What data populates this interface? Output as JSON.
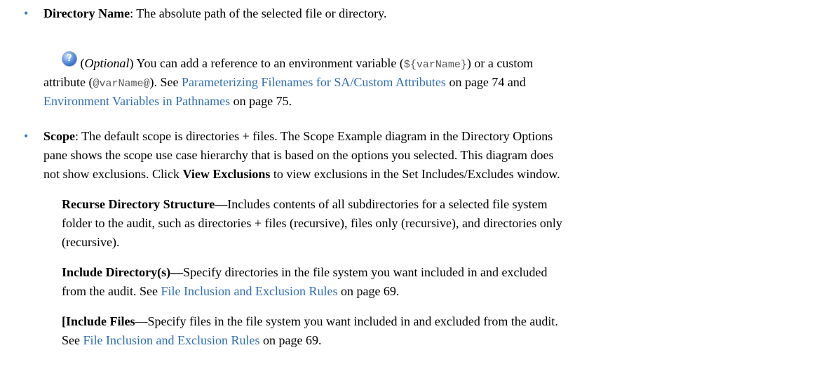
{
  "bullet_char": "•",
  "directory_name": {
    "label": "Directory Name",
    "text": ": The absolute path of the selected file or directory."
  },
  "optional_note": {
    "help_icon_glyph": "?",
    "open_paren": "(",
    "optional_word": "Optional",
    "text1": ") You can add a reference to an environment variable (",
    "code1": "${varName}",
    "text2": ") or a custom",
    "text3": "attribute (",
    "code2": "@varName@",
    "text4": "). See ",
    "link1": "Parameterizing Filenames for SA/Custom Attributes",
    "text5": " on page 74 and",
    "link2": "Environment Variables in Pathnames",
    "text6": " on page 75."
  },
  "scope": {
    "label": "Scope",
    "text1": ": The default scope is directories + files. The Scope Example diagram in the Directory Options",
    "text2": "pane shows the scope use case hierarchy that is based on the options you selected. This diagram does",
    "text3": "not show exclusions. Click ",
    "view_exclusions": "View Exclusions",
    "text4": " to view exclusions in the Set Includes/Excludes window."
  },
  "recurse": {
    "label": "Recurse Directory Structure—",
    "text1": "Includes contents of all subdirectories for a selected file system",
    "text2": "folder to the audit, such as directories + files (recursive), files only (recursive), and directories only",
    "text3": "(recursive)."
  },
  "include_dirs": {
    "label": "Include Directory(s)—",
    "text1": "Specify directories in the file system you want included in and excluded",
    "text2": "from the audit. See ",
    "link": "File Inclusion and Exclusion Rules",
    "text3": " on page 69."
  },
  "include_files": {
    "label": "[Include Files",
    "text1": "—Specify files in the file system you want included in and excluded from the audit.",
    "text2": "See ",
    "link": "File Inclusion and Exclusion Rules",
    "text3": " on page 69."
  }
}
